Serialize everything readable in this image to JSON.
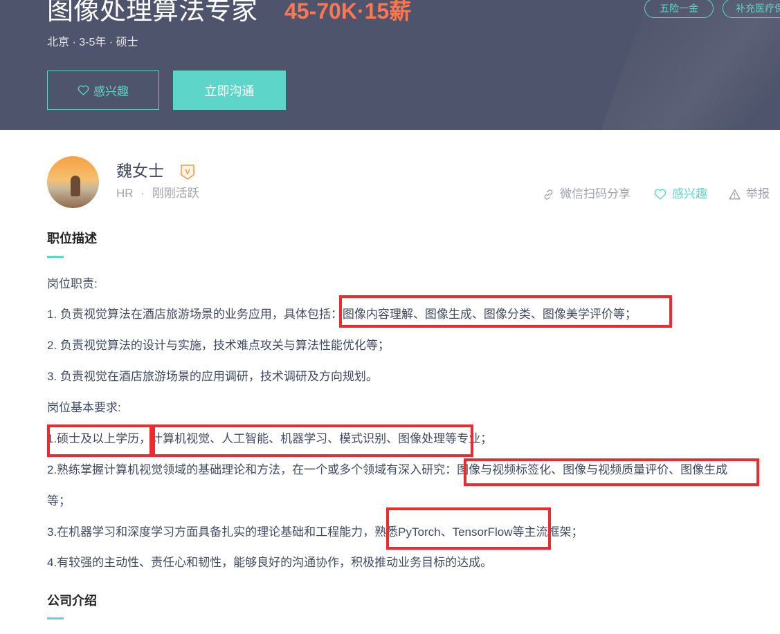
{
  "banner": {
    "title": "图像处理算法专家",
    "salary": "45-70K·15薪",
    "meta": "北京 · 3-5年 · 硕士",
    "tags": [
      "五险一金",
      "补充医疗保"
    ],
    "interest_label": "感兴趣",
    "chat_label": "立即沟通"
  },
  "recruiter": {
    "name": "魏女士",
    "verified_glyph": "V",
    "role": "HR",
    "separator": "·",
    "status": "刚刚活跃"
  },
  "actions": {
    "share": "微信扫码分享",
    "interest": "感兴趣",
    "report": "举报"
  },
  "description": {
    "title": "职位描述",
    "lines": [
      "岗位职责:",
      "1. 负责视觉算法在酒店旅游场景的业务应用，具体包括：图像内容理解、图像生成、图像分类、图像美学评价等；",
      "2. 负责视觉算法的设计与实施，技术难点攻关与算法性能优化等；",
      "3. 负责视觉在酒店旅游场景的应用调研，技术调研及方向规划。",
      "岗位基本要求:",
      "1.硕士及以上学历，计算机视觉、人工智能、机器学习、模式识别、图像处理等专业；",
      "2.熟练掌握计算机视觉领域的基础理论和方法，在一个或多个领域有深入研究：图像与视频标签化、图像与视频质量评价、图像生成",
      "等；",
      "3.在机器学习和深度学习方面具备扎实的理论基础和工程能力，熟悉PyTorch、TensorFlow等主流框架；",
      "4.有较强的主动性、责任心和韧性，能够良好的沟通协作，积极推动业务目标的达成。"
    ]
  },
  "company": {
    "title": "公司介绍"
  },
  "colors": {
    "banner_bg": "#4e546b",
    "accent": "#5dd5c8",
    "salary": "#fe7750",
    "highlight_box": "#ee2a2f"
  },
  "icons": {
    "interest": "heart-outline-icon",
    "verified": "verified-badge-icon",
    "share": "link-icon",
    "report": "warning-icon"
  }
}
